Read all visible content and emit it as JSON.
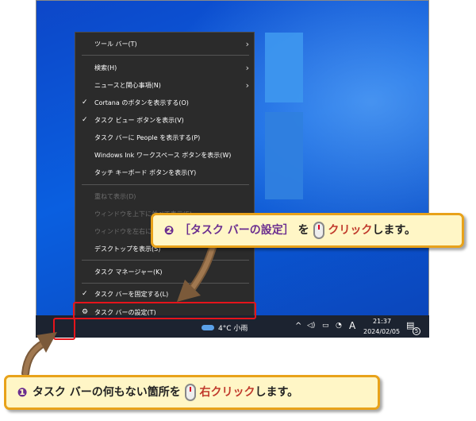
{
  "menu": {
    "items": [
      {
        "label": "ツール バー(T)",
        "submenu": true
      },
      {
        "label": "検索(H)",
        "submenu": true
      },
      {
        "label": "ニュースと関心事項(N)",
        "submenu": true
      },
      {
        "label": "Cortana のボタンを表示する(O)",
        "checked": true
      },
      {
        "label": "タスク ビュー ボタンを表示(V)",
        "checked": true
      },
      {
        "label": "タスク バーに People を表示する(P)"
      },
      {
        "label": "Windows Ink ワークスペース ボタンを表示(W)"
      },
      {
        "label": "タッチ キーボード ボタンを表示(Y)"
      },
      {
        "label": "重ねて表示(D)",
        "disabled": true
      },
      {
        "label": "ウィンドウを上下に並べて表示(E)",
        "disabled": true
      },
      {
        "label": "ウィンドウを左右に並べて表示(I)",
        "disabled": true
      },
      {
        "label": "デスクトップを表示(S)"
      },
      {
        "label": "タスク マネージャー(K)"
      },
      {
        "label": "タスク バーを固定する(L)",
        "checked": true
      },
      {
        "label": "タスク バーの設定(T)",
        "gear": true
      }
    ]
  },
  "taskbar": {
    "weather": "4°C 小雨",
    "ime": "A",
    "time": "21:37",
    "date": "2024/02/05",
    "notifications": "5"
  },
  "callout1": {
    "num": "❶",
    "text_a": "タスク バーの何もない箇所を",
    "text_b": "右クリック",
    "text_c": "します。"
  },
  "callout2": {
    "num": "❷",
    "text_a": "［タスク バーの設定］",
    "text_b": "を",
    "text_c": "クリック",
    "text_d": "します。"
  },
  "colors": {
    "highlight": "#e5141b",
    "callout_border": "#e8a21a",
    "callout_bg": "#fff6c6",
    "accent_text": "#c0392b",
    "purple": "#6a2d8f"
  }
}
